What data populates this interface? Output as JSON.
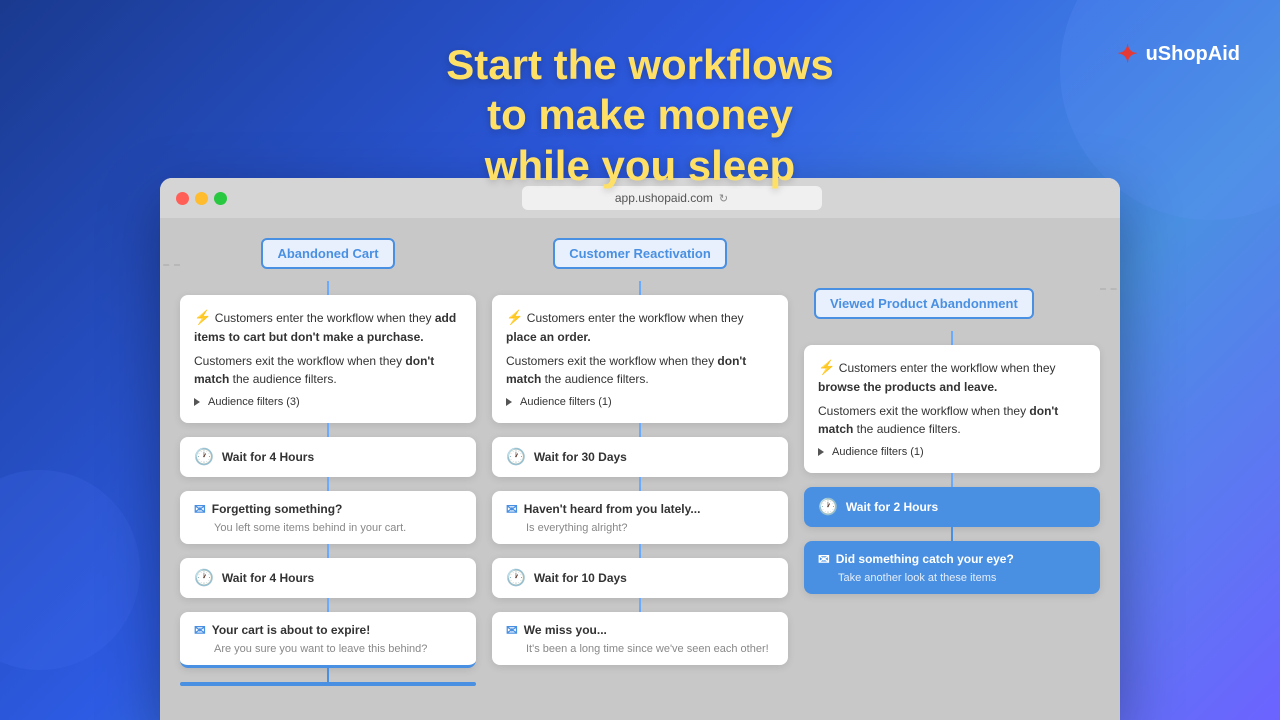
{
  "header": {
    "headline_line1": "Start the workflows to make money",
    "headline_line2": "while you sleep",
    "logo_name": "uShopAid"
  },
  "browser": {
    "url": "app.ushopaid.com"
  },
  "columns": [
    {
      "id": "col1",
      "tab": "Abandoned Cart",
      "cards": [
        {
          "type": "trigger",
          "text1": "Customers enter the workflow when they ",
          "bold1": "add items to cart but don't make a purchase.",
          "text2": "Customers exit the workflow when they ",
          "bold2": "don't match",
          "text3": " the audience filters.",
          "audience": "Audience filters (3)"
        },
        {
          "type": "wait",
          "label": "Wait for 4 Hours"
        },
        {
          "type": "email",
          "subject": "Forgetting something?",
          "preview": "You left some items behind in your cart."
        },
        {
          "type": "wait",
          "label": "Wait for 4 Hours"
        },
        {
          "type": "email",
          "subject": "Your cart is about to expire!",
          "preview": "Are you sure you want to leave this behind?"
        }
      ]
    },
    {
      "id": "col2",
      "tab": "Customer Reactivation",
      "cards": [
        {
          "type": "trigger",
          "text1": "Customers enter the workflow when they ",
          "bold1": "place an order.",
          "text2": "Customers exit the workflow when they ",
          "bold2": "don't match",
          "text3": " the audience filters.",
          "audience": "Audience filters (1)"
        },
        {
          "type": "wait",
          "label": "Wait for 30 Days"
        },
        {
          "type": "email",
          "subject": "Haven't heard from you lately...",
          "preview": "Is everything alright?"
        },
        {
          "type": "wait",
          "label": "Wait for 10 Days"
        },
        {
          "type": "email",
          "subject": "We miss you...",
          "preview": "It's been a long time since we've seen each other!"
        }
      ]
    },
    {
      "id": "col3",
      "tab": "Viewed Product Abandonment",
      "cards": [
        {
          "type": "trigger",
          "text1": "Customers enter the workflow when they ",
          "bold1": "browse the products and leave.",
          "text2": "Customers exit the workflow when they ",
          "bold2": "don't match",
          "text3": " the audience filters.",
          "audience": "Audience filters (1)"
        },
        {
          "type": "wait",
          "label": "Wait for 2 Hours",
          "style": "blue"
        },
        {
          "type": "email",
          "subject": "Did something catch your eye?",
          "preview": "Take another look at these items",
          "style": "blue"
        }
      ]
    }
  ],
  "icons": {
    "lightning": "⚡",
    "clock": "🕐",
    "email": "✉",
    "refresh": "↻",
    "logo": "✦"
  }
}
